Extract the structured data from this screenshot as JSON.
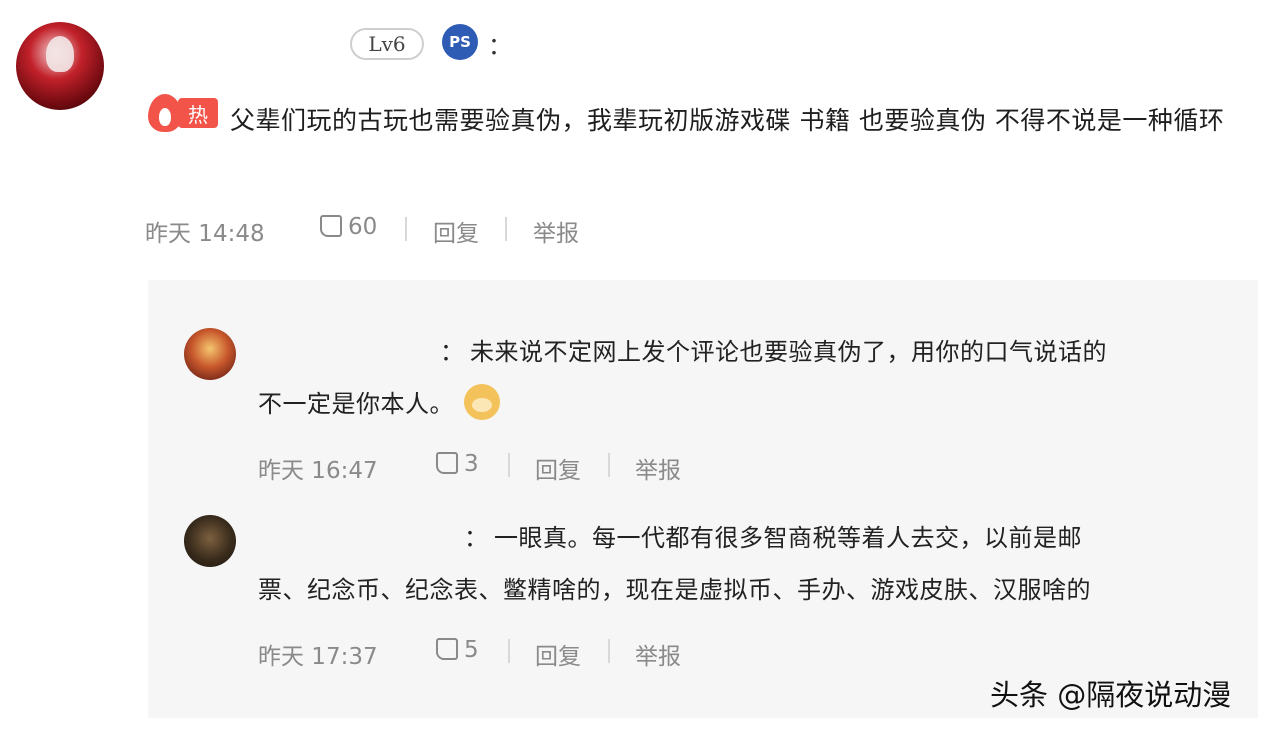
{
  "main_comment": {
    "level_badge": "Lv6",
    "platform_icon": "playstation-icon",
    "colon": "：",
    "hot_label": "热",
    "text": "父辈们玩的古玩也需要验真伪，我辈玩初版游戏碟 书籍 也要验真伪 不得不说是一种循环",
    "time": "昨天 14:48",
    "likes": "60",
    "reply_label": "回复",
    "report_label": "举报"
  },
  "replies": [
    {
      "colon": "：",
      "text_line1": "未来说不定网上发个评论也要验真伪了，用你的口气说话的",
      "text_line2": "不一定是你本人。",
      "emoji": "dog-emoji",
      "time": "昨天 16:47",
      "likes": "3",
      "reply_label": "回复",
      "report_label": "举报"
    },
    {
      "colon": "：",
      "text_line1": "一眼真。每一代都有很多智商税等着人去交，以前是邮",
      "text_line2": "票、纪念币、纪念表、鳖精啥的，现在是虚拟币、手办、游戏皮肤、汉服啥的",
      "time": "昨天 17:37",
      "likes": "5",
      "reply_label": "回复",
      "report_label": "举报"
    }
  ],
  "watermark": "头条 @隔夜说动漫",
  "colors": {
    "hot": "#f2544a",
    "meta": "#8a8a8a",
    "reply_bg": "#f6f6f6"
  }
}
